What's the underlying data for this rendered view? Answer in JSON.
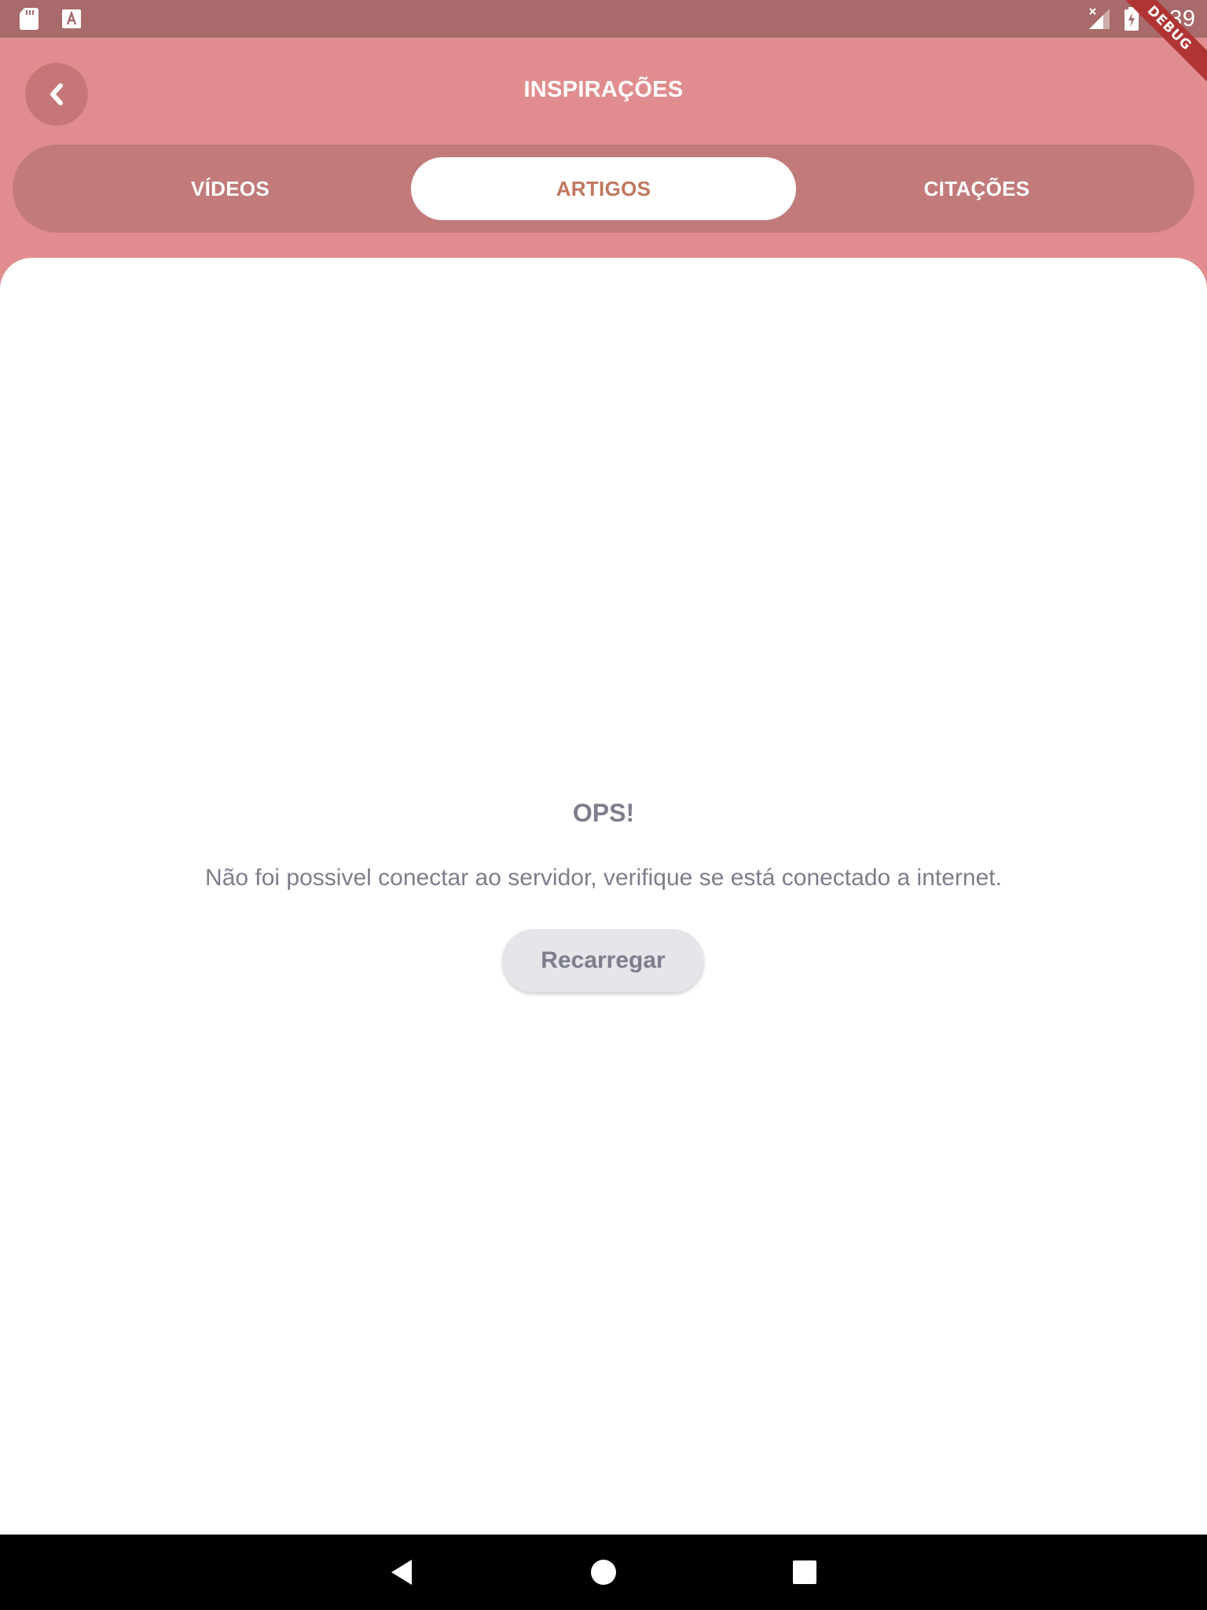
{
  "status_bar": {
    "time": "9:39",
    "icons": [
      "sd-card-icon",
      "keyboard-a-icon",
      "signal-off-icon",
      "battery-charging-icon"
    ]
  },
  "debug_banner": "DEBUG",
  "header": {
    "title": "INSPIRAÇÕES",
    "back_icon": "chevron-left-icon"
  },
  "tabs": [
    {
      "label": "VÍDEOS",
      "active": false
    },
    {
      "label": "ARTIGOS",
      "active": true
    },
    {
      "label": "CITAÇÕES",
      "active": false
    }
  ],
  "error": {
    "title": "OPS!",
    "message": "Não foi possivel conectar ao servidor, verifique se está conectado a internet.",
    "reload_label": "Recarregar"
  },
  "nav_bar": {
    "icons": [
      "back-triangle-icon",
      "home-circle-icon",
      "recents-square-icon"
    ]
  },
  "colors": {
    "header_bg": "#e18d8f",
    "status_bar_bg": "#a86a6a",
    "tab_bar_bg": "#c27a7b",
    "active_tab_text": "#c0765e",
    "error_text": "#7d7e8c",
    "reload_button_bg": "#e5e5ea",
    "debug_ribbon": "#b03434"
  }
}
